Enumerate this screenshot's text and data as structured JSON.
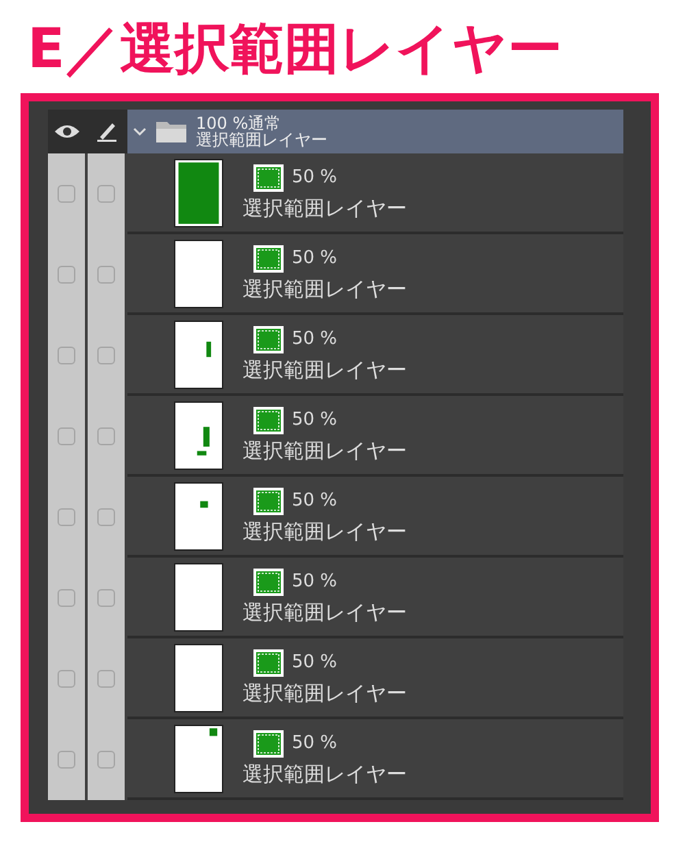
{
  "title": "E／選択範囲レイヤー",
  "folder": {
    "opacity_mode": "100 %通常",
    "name": "選択範囲レイヤー"
  },
  "layers": [
    {
      "visible": false,
      "locked": false,
      "opacity": "50 %",
      "name": "選択範囲レイヤー"
    },
    {
      "visible": false,
      "locked": false,
      "opacity": "50 %",
      "name": "選択範囲レイヤー"
    },
    {
      "visible": false,
      "locked": false,
      "opacity": "50 %",
      "name": "選択範囲レイヤー"
    },
    {
      "visible": false,
      "locked": false,
      "opacity": "50 %",
      "name": "選択範囲レイヤー"
    },
    {
      "visible": false,
      "locked": false,
      "opacity": "50 %",
      "name": "選択範囲レイヤー"
    },
    {
      "visible": false,
      "locked": false,
      "opacity": "50 %",
      "name": "選択範囲レイヤー"
    },
    {
      "visible": false,
      "locked": false,
      "opacity": "50 %",
      "name": "選択範囲レイヤー"
    },
    {
      "visible": false,
      "locked": false,
      "opacity": "50 %",
      "name": "選択範囲レイヤー"
    }
  ]
}
